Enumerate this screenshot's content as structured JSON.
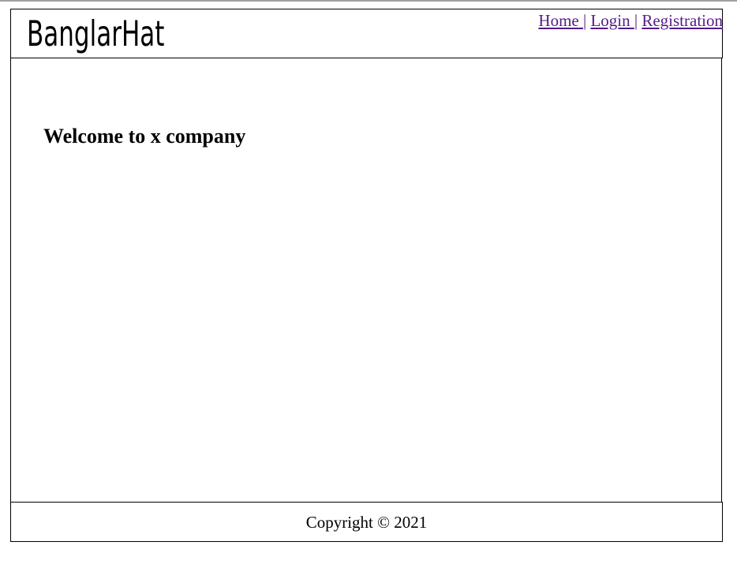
{
  "header": {
    "logo_text": "BanglarHat",
    "nav": {
      "home": "Home ",
      "login": "Login ",
      "registration": "Registration",
      "separator": "|"
    }
  },
  "main": {
    "heading": "Welcome to x company"
  },
  "footer": {
    "copyright": "Copyright © 2021"
  },
  "colors": {
    "link": "#551a8b",
    "border": "#000000"
  }
}
